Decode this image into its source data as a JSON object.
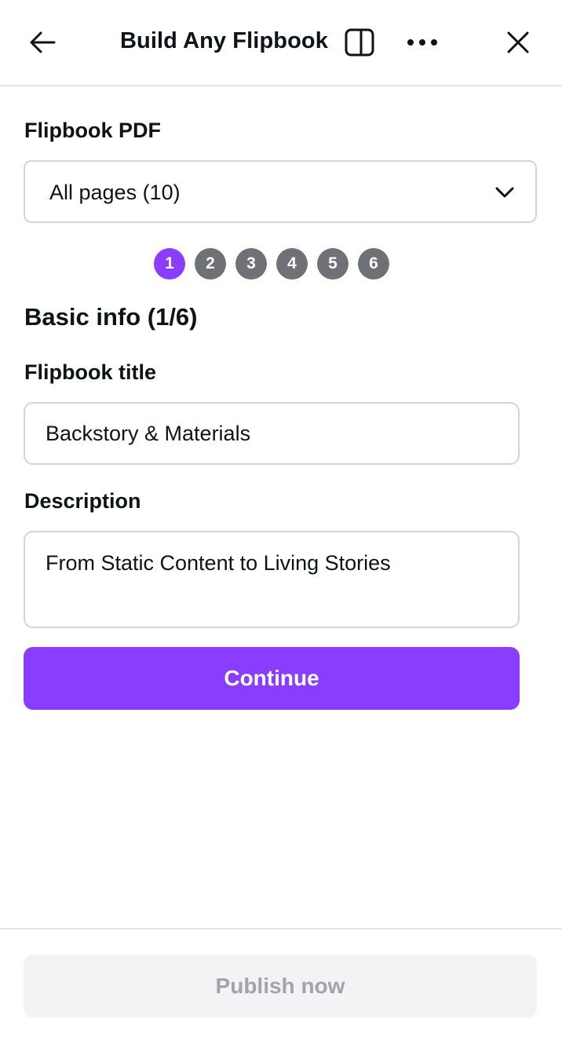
{
  "header": {
    "title": "Build Any Flipbook",
    "icons": [
      "arrow-left-icon",
      "side-panel-icon",
      "more-horizontal-icon",
      "close-icon"
    ]
  },
  "pdf_section": {
    "label": "Flipbook PDF",
    "select_value": "All pages (10)"
  },
  "steps": {
    "items": [
      "1",
      "2",
      "3",
      "4",
      "5",
      "6"
    ],
    "active": "1",
    "active_color": "#8b3dff",
    "inactive_color": "#6f7177"
  },
  "basic_info": {
    "title": "Basic info (1/6)",
    "title_label": "Flipbook title",
    "title_value": "Backstory & Materials",
    "description_label": "Description",
    "description_value": "From Static Content to Living Stories"
  },
  "actions": {
    "continue_label": "Continue",
    "publish_label": "Publish now"
  },
  "colors": {
    "accent": "#8b3dff",
    "disabled_bg": "#f2f3f5",
    "disabled_text": "#a1a4aa"
  }
}
